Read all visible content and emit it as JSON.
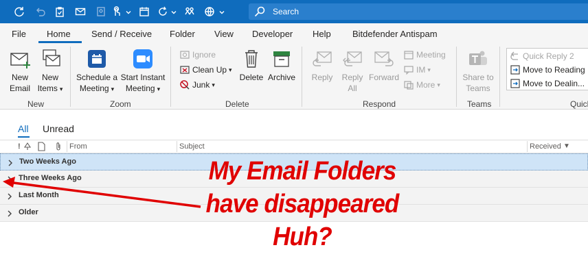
{
  "titlebar": {
    "search_placeholder": "Search",
    "icons": [
      "refresh-icon",
      "undo-icon",
      "task-icon",
      "mail-icon",
      "contacts-icon",
      "touch-icon",
      "calendar-icon",
      "forward-icon",
      "people-icon",
      "globe-icon"
    ]
  },
  "menu": {
    "tabs": [
      "File",
      "Home",
      "Send / Receive",
      "Folder",
      "View",
      "Developer",
      "Help",
      "Bitdefender Antispam"
    ],
    "active": "Home"
  },
  "ribbon": {
    "groups": {
      "new": "New",
      "zoom": "Zoom",
      "delete": "Delete",
      "respond": "Respond",
      "teams": "Teams",
      "quick": "Quick"
    },
    "new_email": [
      "New",
      "Email"
    ],
    "new_items": [
      "New",
      "Items"
    ],
    "schedule_meeting": [
      "Schedule a",
      "Meeting"
    ],
    "instant_meeting": [
      "Start Instant",
      "Meeting"
    ],
    "ignore": "Ignore",
    "clean_up": "Clean Up",
    "junk": "Junk",
    "delete": "Delete",
    "archive": "Archive",
    "reply": "Reply",
    "reply_all": [
      "Reply",
      "All"
    ],
    "forward": "Forward",
    "meeting": "Meeting",
    "im": "IM",
    "more": "More",
    "share_teams": [
      "Share to",
      "Teams"
    ],
    "quick_steps": [
      "Quick Reply 2",
      "Move to Reading",
      "Move to Dealin..."
    ]
  },
  "view": {
    "filters": [
      "All",
      "Unread"
    ],
    "columns": {
      "from": "From",
      "subject": "Subject",
      "received": "Received"
    },
    "groups": [
      {
        "label": "Two Weeks Ago",
        "selected": true
      },
      {
        "label": "Three Weeks Ago",
        "selected": false
      },
      {
        "label": "Last Month",
        "selected": false
      },
      {
        "label": "Older",
        "selected": false
      }
    ]
  },
  "annotation": {
    "lines": [
      "My Email Folders",
      "have disappeared",
      "Huh?"
    ],
    "color": "#e00000"
  },
  "colors": {
    "accent": "#0f6cbd",
    "ribbon_bg": "#f5f5f5",
    "selected_row": "#cfe4f7"
  }
}
